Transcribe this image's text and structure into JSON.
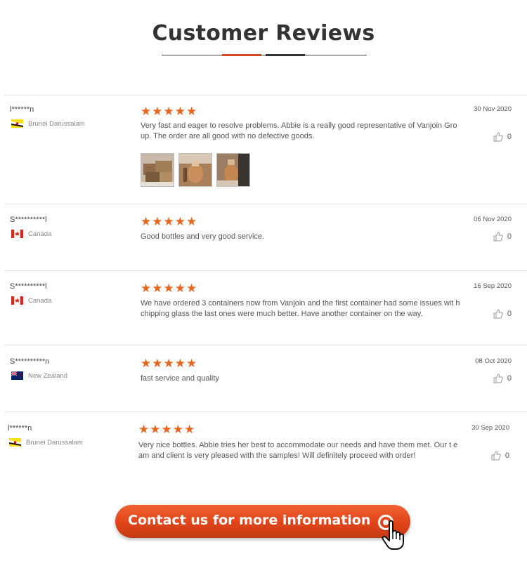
{
  "page": {
    "title": "Customer Reviews"
  },
  "reviews": [
    {
      "user": "l******n",
      "country": "Brunei Darussalam",
      "flag": "brunei",
      "rating": 5,
      "stars": "★★★★★",
      "text": "Very fast and eager to resolve problems. Abbie is a really good representative of Vanjoin Gro up. The order are all good with no defective goods.",
      "date": "30 Nov 2020",
      "likes": "0",
      "photos": [
        "review-photo-boxes",
        "review-photo-bottle-1",
        "review-photo-bottle-2"
      ]
    },
    {
      "user": "S**********l",
      "country": "Canada",
      "flag": "canada",
      "rating": 5,
      "stars": "★★★★★",
      "text": "Good bottles and very good service.",
      "date": "06 Nov 2020",
      "likes": "0"
    },
    {
      "user": "S**********l",
      "country": "Canada",
      "flag": "canada",
      "rating": 5,
      "stars": "★★★★★",
      "text": "We have ordered 3 containers now from Vanjoin and the first container had some issues wit h chipping glass the last ones were much better. Have another container on the way.",
      "date": "16 Sep 2020",
      "likes": "0"
    },
    {
      "user": "S**********n",
      "country": "New Zealand",
      "flag": "new-zealand",
      "rating": 5,
      "stars": "★★★★★",
      "text": "fast service and quality",
      "date": "08 Oct 2020",
      "likes": "0"
    },
    {
      "user": "l******n",
      "country": "Brunei Darussalam",
      "flag": "brunei",
      "rating": 5,
      "stars": "★★★★★",
      "text": "Very nice bottles. Abbie tries her best to accommodate our needs and have them met. Our t eam and client is very pleased with the samples! Will definitely proceed with order!",
      "date": "30 Sep 2020",
      "likes": "0"
    }
  ],
  "cta": {
    "label": "Contact us for more information"
  },
  "colors": {
    "accent": "#e8651e",
    "button": "#e0451a",
    "heading": "#333333"
  }
}
